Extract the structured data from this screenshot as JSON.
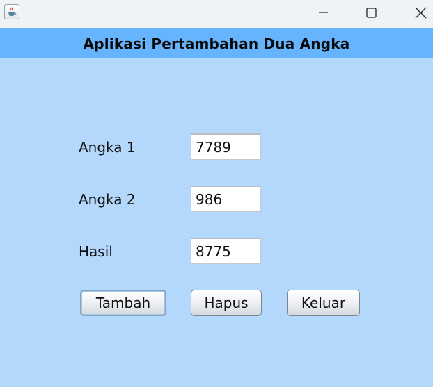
{
  "window": {
    "icon": "java-cup-icon",
    "controls": [
      "minimize-icon",
      "maximize-icon",
      "close-icon"
    ]
  },
  "header": {
    "title": "Aplikasi Pertambahan Dua Angka"
  },
  "form": {
    "angka1_label": "Angka 1",
    "angka1_value": "7789",
    "angka2_label": "Angka 2",
    "angka2_value": "986",
    "hasil_label": "Hasil",
    "hasil_value": "8775"
  },
  "buttons": {
    "tambah": "Tambah",
    "hapus": "Hapus",
    "keluar": "Keluar"
  },
  "colors": {
    "background": "#b3d8fc",
    "header": "#66b3fe",
    "titlebar": "#f0f3f5"
  }
}
